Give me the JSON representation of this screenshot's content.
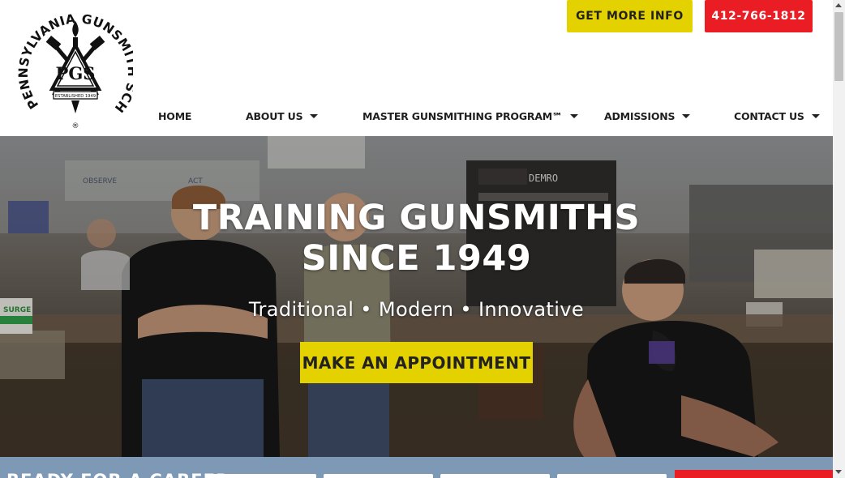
{
  "logo": {
    "arc_text": "PENNSYLVANIA GUNSMITH SCHOOL",
    "monogram": "PGS",
    "ribbon": "ESTABLISHED 1949",
    "registered": "®"
  },
  "top_buttons": {
    "info_label": "GET MORE INFO",
    "phone_label": "412-766-1812"
  },
  "nav": {
    "items": [
      {
        "label": "HOME",
        "has_dropdown": false
      },
      {
        "label": "ABOUT US",
        "has_dropdown": true
      },
      {
        "label": "MASTER GUNSMITHING PROGRAM℠",
        "has_dropdown": true
      },
      {
        "label": "ADMISSIONS",
        "has_dropdown": true
      },
      {
        "label": "CONTACT US",
        "has_dropdown": true
      }
    ]
  },
  "hero": {
    "title_line1": "TRAINING GUNSMITHS",
    "title_line2": "SINCE 1949",
    "tagline": "Traditional • Modern • Innovative",
    "cta_label": "MAKE AN APPOINTMENT",
    "wall_sign_1": "OBSERVE",
    "wall_sign_2": "ACT",
    "machine_label": "DEMRO",
    "bucket_label": "SURGE"
  },
  "band": {
    "text": "READY FOR A CAREER"
  },
  "colors": {
    "accent_yellow": "#e3d100",
    "accent_red": "#ea1c24",
    "band_blue": "#7d99b6",
    "nav_text": "#1f1f1f"
  }
}
